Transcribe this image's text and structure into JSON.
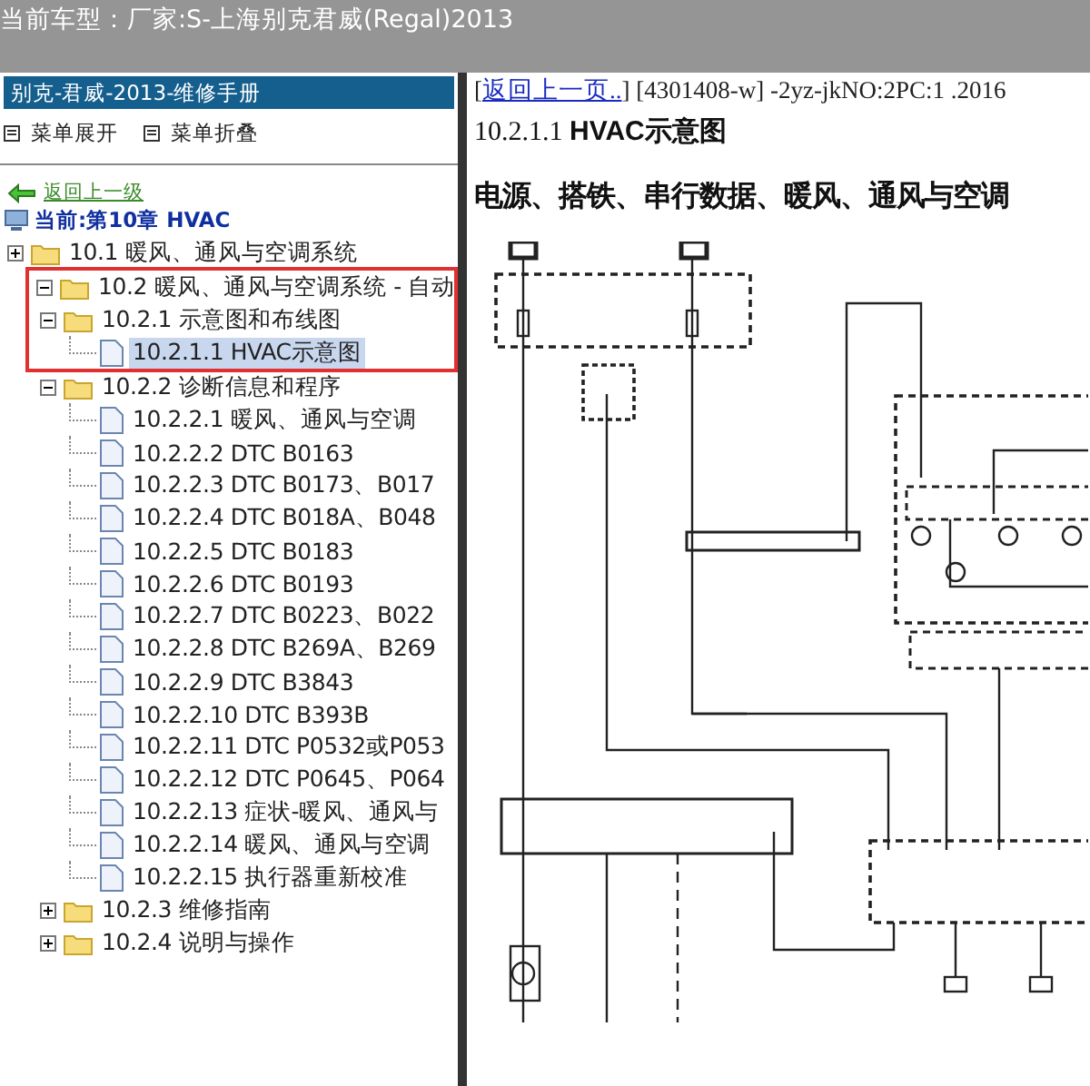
{
  "top_bar": {
    "title": "当前车型：厂家:S-上海别克君威(Regal)2013"
  },
  "sidebar": {
    "title": "别克-君威-2013-维修手册",
    "menu": [
      {
        "label": "菜单展开"
      },
      {
        "label": "菜单折叠"
      }
    ],
    "back_link": "返回上一级",
    "current": "当前:第10章 HVAC",
    "tree": [
      {
        "label": "10.1 暖风、通风与空调系统",
        "kind": "folder",
        "expanded": false,
        "selected": false,
        "highlighted": false
      },
      {
        "label": "10.2 暖风、通风与空调系统 - 自动",
        "kind": "folder",
        "expanded": true,
        "selected": false,
        "highlighted": true,
        "children": [
          {
            "label": "10.2.1 示意图和布线图",
            "kind": "folder",
            "expanded": true,
            "selected": false,
            "highlighted": true,
            "children": [
              {
                "label": "10.2.1.1 HVAC示意图",
                "kind": "page",
                "selected": true,
                "highlighted": true
              }
            ]
          },
          {
            "label": "10.2.2 诊断信息和程序",
            "kind": "folder",
            "expanded": true,
            "selected": false,
            "highlighted": false,
            "children": [
              {
                "label": "10.2.2.1 暖风、通风与空调",
                "kind": "page",
                "selected": false,
                "highlighted": false
              },
              {
                "label": "10.2.2.2 DTC B0163",
                "kind": "page",
                "selected": false,
                "highlighted": false
              },
              {
                "label": "10.2.2.3 DTC B0173、B017",
                "kind": "page",
                "selected": false,
                "highlighted": false
              },
              {
                "label": "10.2.2.4 DTC B018A、B048",
                "kind": "page",
                "selected": false,
                "highlighted": false
              },
              {
                "label": "10.2.2.5 DTC B0183",
                "kind": "page",
                "selected": false,
                "highlighted": false
              },
              {
                "label": "10.2.2.6 DTC B0193",
                "kind": "page",
                "selected": false,
                "highlighted": false
              },
              {
                "label": "10.2.2.7 DTC B0223、B022",
                "kind": "page",
                "selected": false,
                "highlighted": false
              },
              {
                "label": "10.2.2.8 DTC B269A、B269",
                "kind": "page",
                "selected": false,
                "highlighted": false
              },
              {
                "label": "10.2.2.9 DTC B3843",
                "kind": "page",
                "selected": false,
                "highlighted": false
              },
              {
                "label": "10.2.2.10 DTC B393B",
                "kind": "page",
                "selected": false,
                "highlighted": false
              },
              {
                "label": "10.2.2.11 DTC P0532或P053",
                "kind": "page",
                "selected": false,
                "highlighted": false
              },
              {
                "label": "10.2.2.12 DTC P0645、P064",
                "kind": "page",
                "selected": false,
                "highlighted": false
              },
              {
                "label": "10.2.2.13 症状-暖风、通风与",
                "kind": "page",
                "selected": false,
                "highlighted": false
              },
              {
                "label": "10.2.2.14 暖风、通风与空调",
                "kind": "page",
                "selected": false,
                "highlighted": false
              },
              {
                "label": "10.2.2.15 执行器重新校准",
                "kind": "page",
                "selected": false,
                "highlighted": false
              }
            ]
          },
          {
            "label": "10.2.3 维修指南",
            "kind": "folder",
            "expanded": false,
            "selected": false,
            "highlighted": false
          },
          {
            "label": "10.2.4 说明与操作",
            "kind": "folder",
            "expanded": false,
            "selected": false,
            "highlighted": false
          }
        ]
      }
    ]
  },
  "content": {
    "link_open": "[",
    "back_link": "返回上一页..",
    "info": "] [4301408-w] -2yz-jkNO:2PC:1 .2016",
    "title": "10.2.1.1 **HVAC示意图**",
    "heading": "电源、搭铁、串行数据、暖风、通风与空调"
  }
}
